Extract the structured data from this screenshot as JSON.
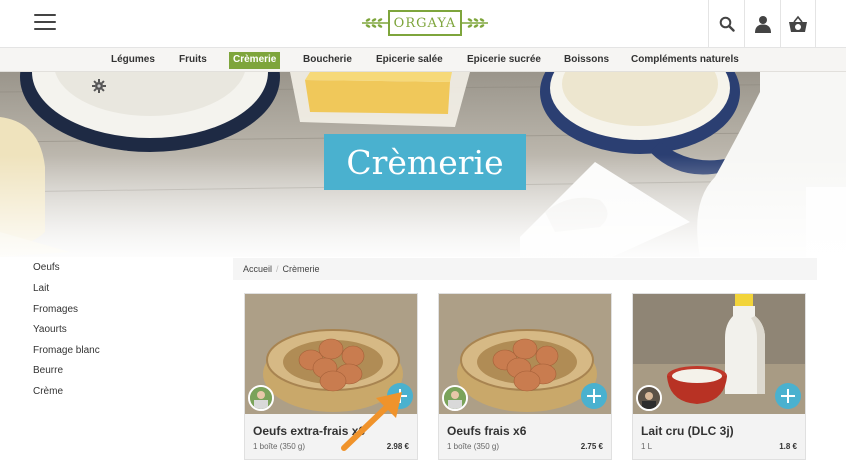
{
  "header": {
    "logo_text": "ORGAYA"
  },
  "nav": {
    "items": [
      "Légumes",
      "Fruits",
      "Crèmerie",
      "Boucherie",
      "Epicerie salée",
      "Epicerie sucrée",
      "Boissons",
      "Compléments naturels"
    ],
    "active": "Crèmerie"
  },
  "hero": {
    "title": "Crèmerie"
  },
  "sidebar": {
    "items": [
      "Oeufs",
      "Lait",
      "Fromages",
      "Yaourts",
      "Fromage blanc",
      "Beurre",
      "Crème"
    ]
  },
  "breadcrumb": {
    "home": "Accueil",
    "separator": "/",
    "current": "Crèmerie"
  },
  "products": [
    {
      "name": "Oeufs extra-frais x6",
      "quantity": "1 boîte (350 g)",
      "price": "2.98 €"
    },
    {
      "name": "Oeufs frais x6",
      "quantity": "1 boîte (350 g)",
      "price": "2.75 €"
    },
    {
      "name": "Lait cru (DLC 3j)",
      "quantity": "1 L",
      "price": "1.8 €"
    }
  ],
  "colors": {
    "brand_green": "#7ea53c",
    "accent_blue": "#4ab1cf",
    "annotation_orange": "#f0932b"
  },
  "icons": [
    "menu-icon",
    "search-icon",
    "user-icon",
    "basket-icon",
    "gear-icon",
    "add-icon"
  ]
}
